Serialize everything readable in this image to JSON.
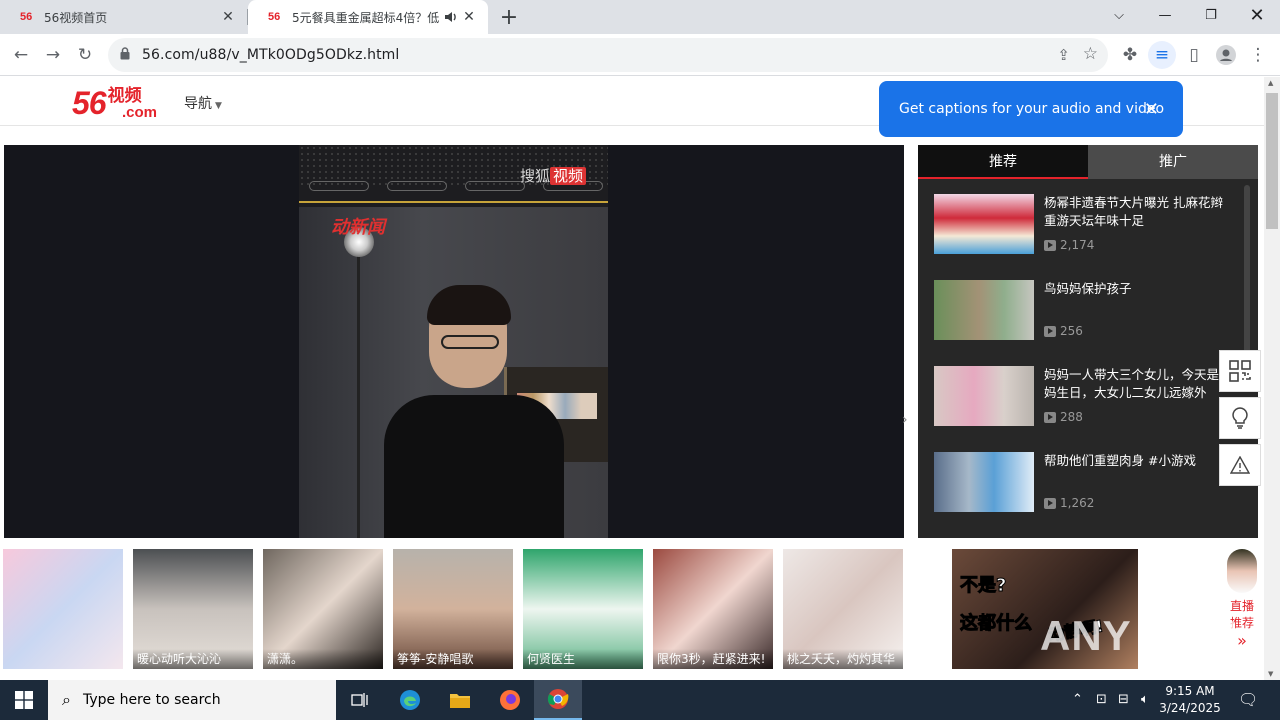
{
  "browser": {
    "tabs": [
      {
        "favicon": "56",
        "title": "56视频首页"
      },
      {
        "favicon": "56",
        "title": "5元餐具重金属超标4倍？低"
      }
    ],
    "url": "56.com/u88/v_MTk0ODg5ODkz.html",
    "caption_bubble": "Get captions for your audio and video"
  },
  "site": {
    "logo_num": "56",
    "logo_cn": "视频",
    "logo_com": ".com",
    "nav_label": "导航"
  },
  "player": {
    "brand": "搜狐",
    "brand_badge": "视频",
    "overlay_logo": "动新闻"
  },
  "sidebar": {
    "tabs": [
      "推荐",
      "推广"
    ],
    "items": [
      {
        "title": "杨幂非遗春节大片曝光 扎麻花辫重游天坛年味十足",
        "views": "2,174"
      },
      {
        "title": "鸟妈妈保护孩子",
        "views": "256"
      },
      {
        "title": "妈妈一人带大三个女儿，今天是妈妈生日，大女儿二女儿远嫁外地,...",
        "views": "288"
      },
      {
        "title": "帮助他们重塑肉身 #小游戏",
        "views": "1,262"
      }
    ]
  },
  "strip": {
    "cards": [
      {
        "caption": ""
      },
      {
        "caption": "暖心动听大沁沁"
      },
      {
        "caption": "潇潇。"
      },
      {
        "caption": "筝筝-安静唱歌"
      },
      {
        "caption": "何贤医生"
      },
      {
        "caption": "限你3秒，赶紧进来!"
      },
      {
        "caption": "桃之夭夭，灼灼其华"
      }
    ],
    "ad": {
      "line1": "不是?",
      "line2": "这都什么",
      "line3": "动静啊!"
    },
    "live": {
      "line1": "直播",
      "line2": "推荐"
    },
    "watermark": "ANY RUN"
  },
  "taskbar": {
    "search_placeholder": "Type here to search",
    "time": "9:15 AM",
    "date": "3/24/2025"
  }
}
